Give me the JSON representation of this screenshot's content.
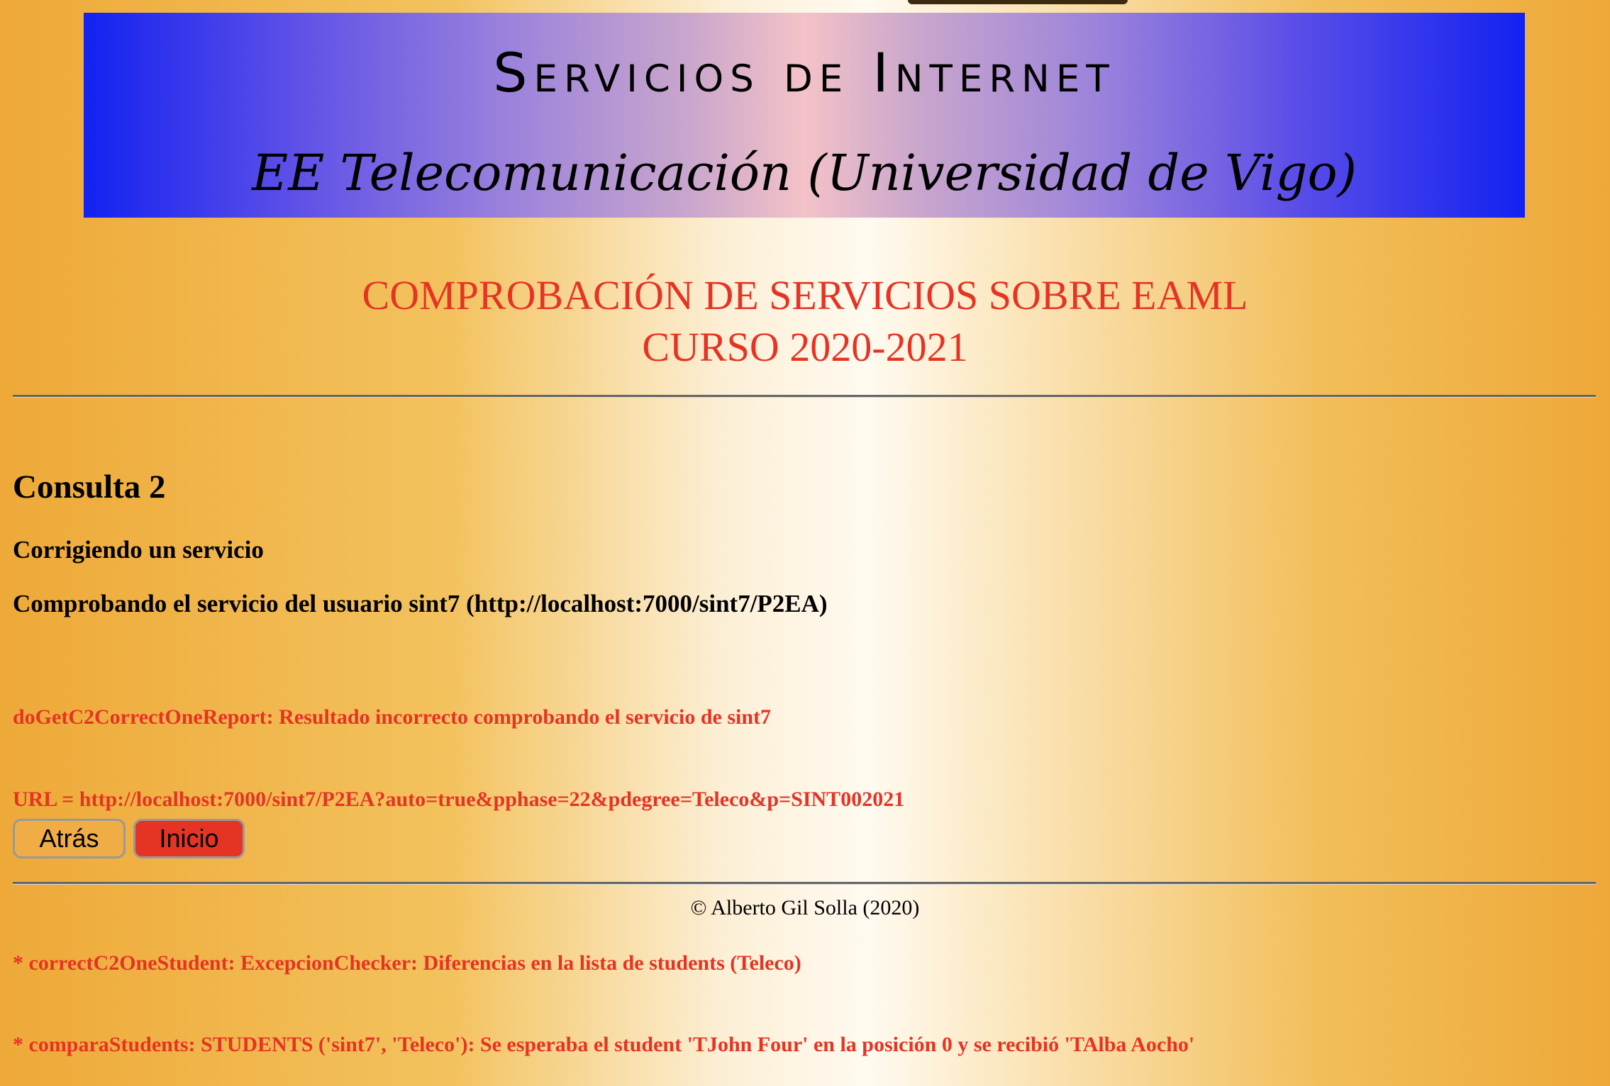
{
  "banner": {
    "title": "Servicios de Internet",
    "subtitle": "EE Telecomunicación (Universidad de Vigo)"
  },
  "heading": {
    "line1": "COMPROBACIÓN DE SERVICIOS SOBRE EAML",
    "line2": "CURSO 2020-2021"
  },
  "content": {
    "consulta": "Consulta 2",
    "subtitle": "Corrigiendo un servicio",
    "checking": "Comprobando el servicio del usuario sint7 (http://localhost:7000/sint7/P2EA)",
    "report_lines": [
      "doGetC2CorrectOneReport: Resultado incorrecto comprobando el servicio de sint7",
      "URL = http://localhost:7000/sint7/P2EA?auto=true&pphase=22&pdegree=Teleco&p=SINT002021",
      "",
      "* correctC2OneStudent: ExcepcionChecker: Diferencias en la lista de students (Teleco)",
      "* comparaStudents: STUDENTS ('sint7', 'Teleco'): Se esperaba el student 'TJohn Four' en la posición 0 y se recibió 'TAlba Aocho'"
    ]
  },
  "buttons": {
    "back_label": "Atrás",
    "home_label": "Inicio"
  },
  "footer": {
    "text": "© Alberto Gil Solla (2020)"
  },
  "colors": {
    "accent_red": "#e53424",
    "banner_blue": "#1222f0",
    "background_orange": "#eea938"
  }
}
